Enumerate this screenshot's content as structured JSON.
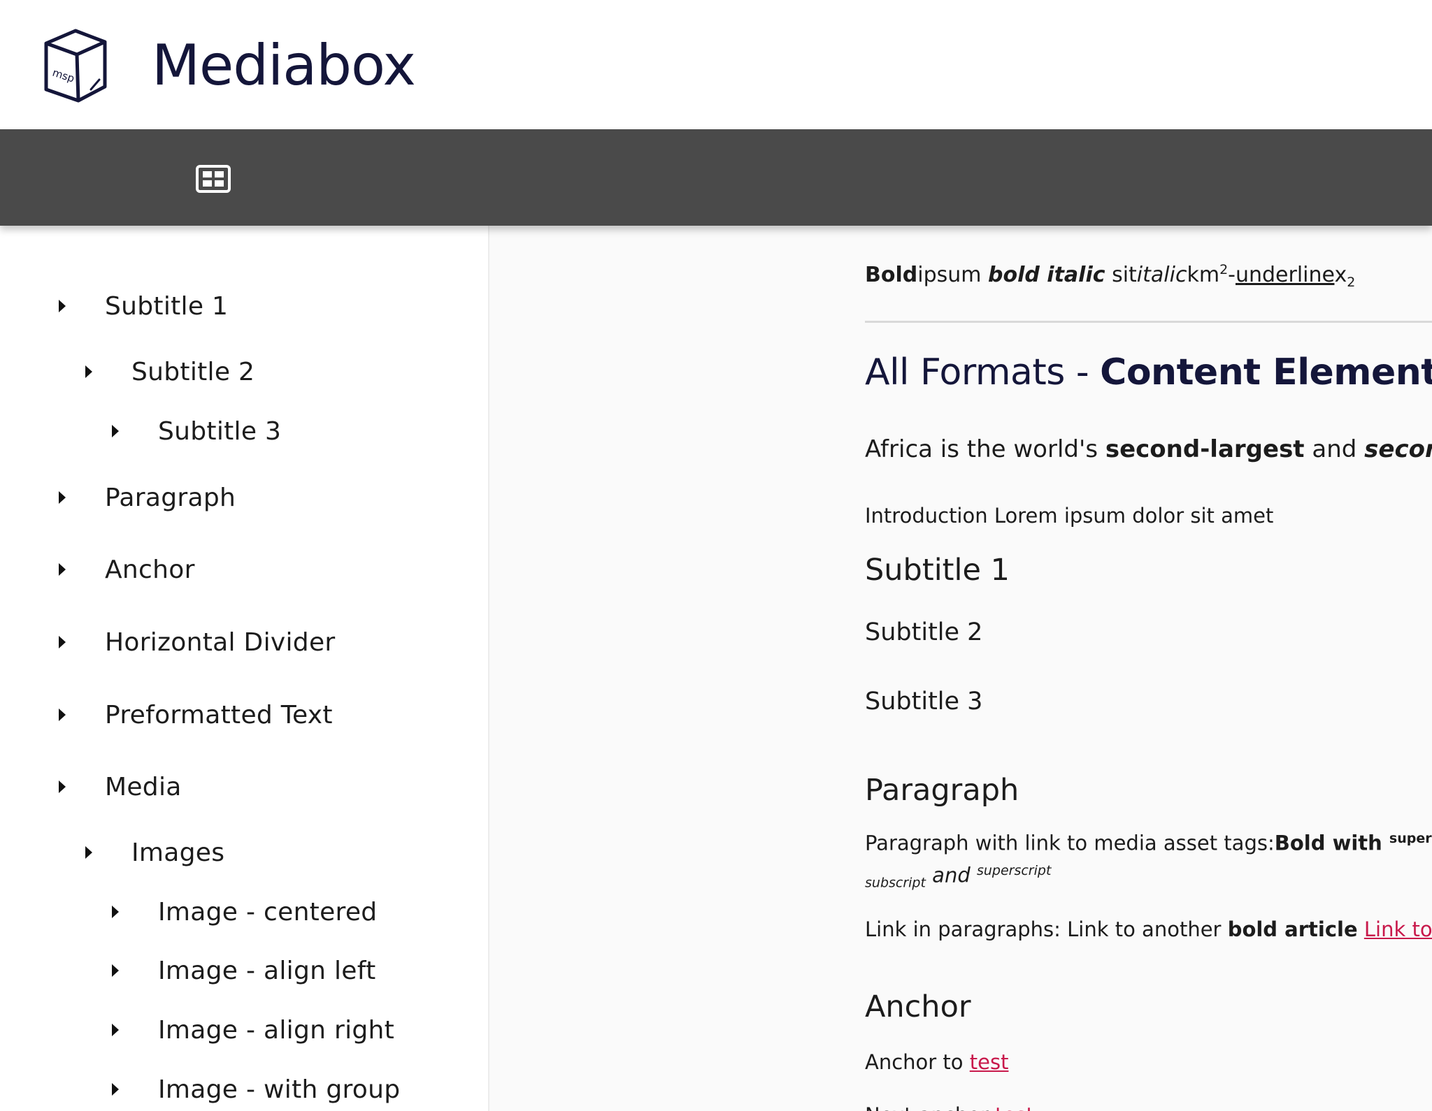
{
  "app": {
    "name": "Mediabox"
  },
  "logo": {
    "text": "msp"
  },
  "toolbar": {
    "toc_icon": "table-of-contents-icon"
  },
  "sidebar": {
    "items": [
      {
        "label": "Subtitle 1",
        "level": 0
      },
      {
        "label": "Subtitle 2",
        "level": 1
      },
      {
        "label": "Subtitle 3",
        "level": 2
      },
      {
        "label": "Paragraph",
        "level": 0
      },
      {
        "label": "Anchor",
        "level": 0
      },
      {
        "label": "Horizontal Divider",
        "level": 0
      },
      {
        "label": "Preformatted Text",
        "level": 0
      },
      {
        "label": "Media",
        "level": 0
      },
      {
        "label": "Images",
        "level": 1
      },
      {
        "label": "Image - centered",
        "level": 2
      },
      {
        "label": "Image - align left",
        "level": 2
      },
      {
        "label": "Image - align right",
        "level": 2
      },
      {
        "label": "Image - with group",
        "level": 2
      }
    ]
  },
  "content": {
    "format_line": {
      "bold": "Bold",
      "plain1": "ipsum ",
      "bold_italic": "bold italic",
      "plain2": " sit",
      "italic": "italic",
      "km": "km",
      "sup": "2",
      "dash": "-",
      "underline": "underline",
      "x": "x",
      "sub": "2"
    },
    "title": {
      "normal": "All Formats - ",
      "bold": "Content Elements"
    },
    "lead": {
      "t1": "Africa is the world's ",
      "b1": "second-largest",
      "t2": " and ",
      "bi1": "second-mo"
    },
    "intro": "Introduction Lorem ipsum dolor sit amet",
    "subtitle1": "Subtitle 1",
    "subtitle2": "Subtitle 2",
    "subtitle3": "Subtitle 3",
    "paragraph_heading": "Paragraph",
    "paragraph1": {
      "text": "Paragraph with link to media asset tags:",
      "bold": "Bold with ",
      "sup": "superscrip"
    },
    "paragraph1_cont": {
      "sub": "subscript",
      "and": " and ",
      "sup": "superscript"
    },
    "paragraph2": {
      "text": "Link in paragraphs: Link to another ",
      "bold": "bold article",
      "space": " ",
      "link": "Link to exte"
    },
    "anchor_heading": "Anchor",
    "anchor_line": {
      "text": "Anchor to ",
      "link": "test"
    },
    "next_line": {
      "text": "Next anchor ",
      "link": "test"
    }
  },
  "colors": {
    "brand": "#14163a",
    "toolbar": "#4a4a4a",
    "link": "#c8194b",
    "content_bg": "#fafafa"
  }
}
